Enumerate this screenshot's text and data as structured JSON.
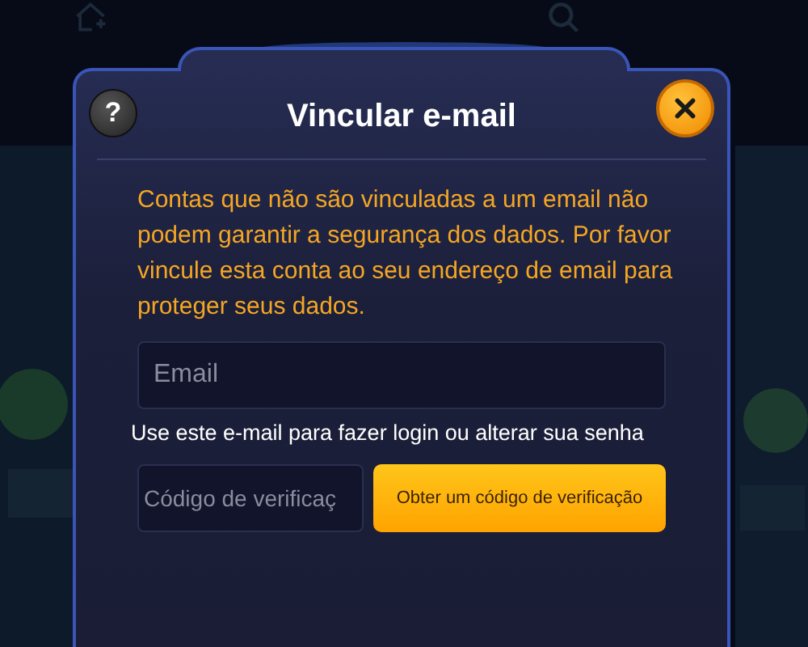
{
  "dialog": {
    "title": "Vincular e-mail",
    "help_button": "?",
    "message": "Contas que não são vinculadas a um email não podem garantir a segurança dos dados. Por favor vincule esta conta ao seu endereço de email para proteger seus dados.",
    "email_field": {
      "placeholder": "Email"
    },
    "email_hint": "Use este e-mail para fazer login ou alterar sua senha",
    "code_field": {
      "placeholder": "Código de verificaç"
    },
    "get_code_button": "Obter um código de verificação"
  }
}
